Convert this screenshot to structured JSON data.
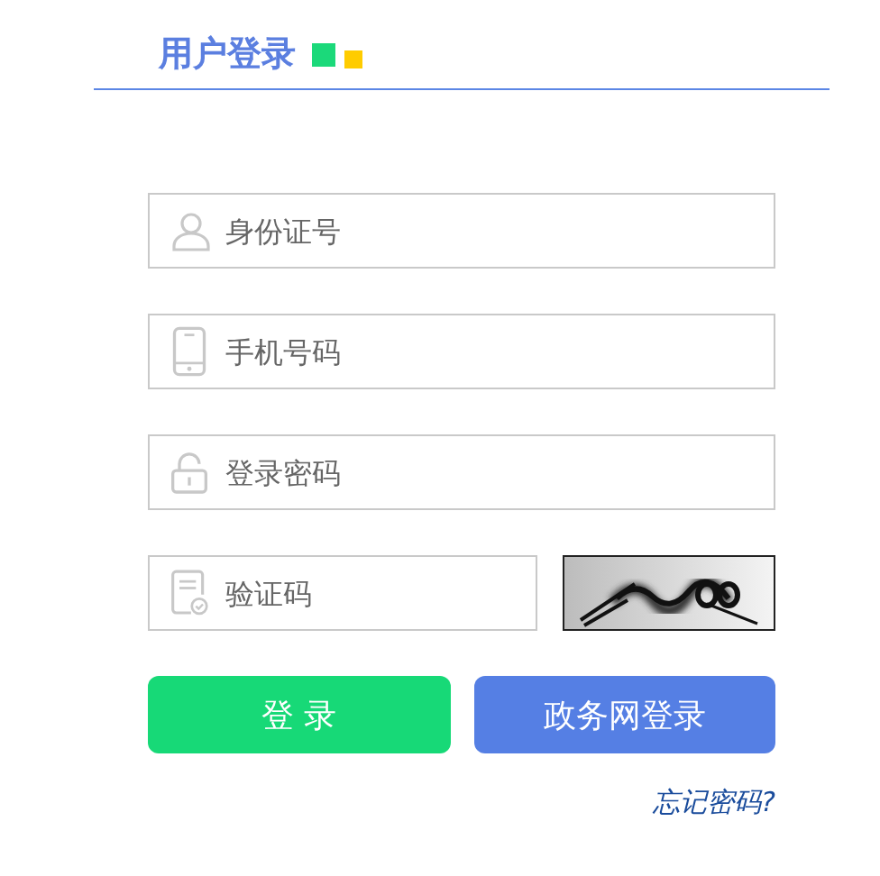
{
  "header": {
    "title": "用户登录"
  },
  "fields": [
    {
      "kind": "id",
      "placeholder": "身份证号"
    },
    {
      "kind": "phone",
      "placeholder": "手机号码"
    },
    {
      "kind": "password",
      "placeholder": "登录密码"
    },
    {
      "kind": "captcha",
      "placeholder": "验证码"
    }
  ],
  "buttons": [
    {
      "kind": "login",
      "label": "登 录"
    },
    {
      "kind": "gov",
      "label": "政务网登录"
    }
  ],
  "forgot_link": "忘记密码?"
}
